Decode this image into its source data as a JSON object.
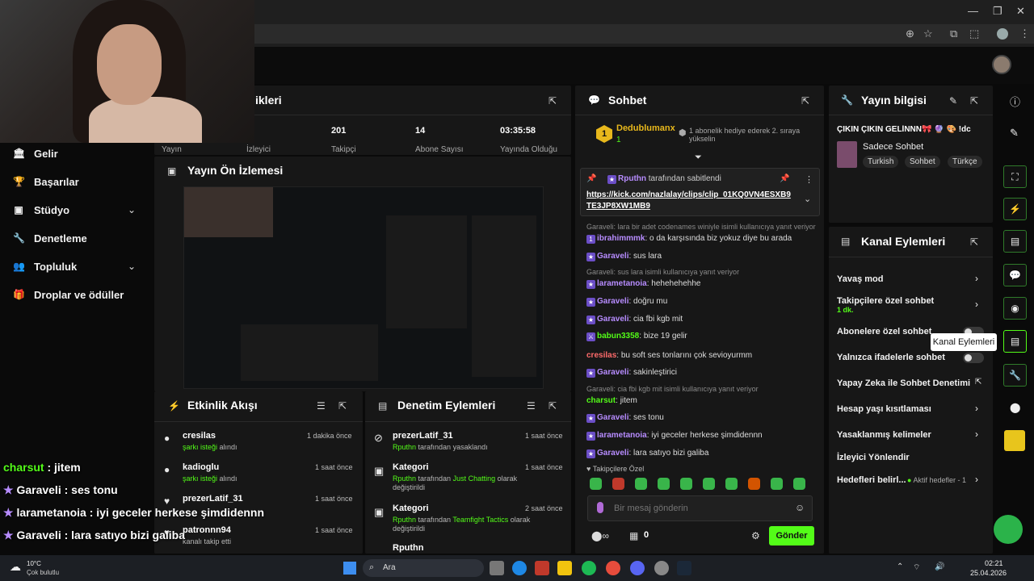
{
  "sidebar": {
    "items": [
      {
        "label": "Gelir",
        "icon": "bank-icon"
      },
      {
        "label": "Başarılar",
        "icon": "trophy-icon"
      },
      {
        "label": "Stüdyo",
        "icon": "studio-icon"
      },
      {
        "label": "Denetleme",
        "icon": "wrench-icon"
      },
      {
        "label": "Topluluk",
        "icon": "community-icon"
      },
      {
        "label": "Droplar ve ödüller",
        "icon": "gift-icon"
      }
    ]
  },
  "stats": {
    "title": "ikleri",
    "items": [
      {
        "value": "",
        "label": "Yayın"
      },
      {
        "value": "",
        "label": "İzleyici"
      },
      {
        "value": "201",
        "label": "Takipçi"
      },
      {
        "value": "14",
        "label": "Abone Sayısı"
      },
      {
        "value": "03:35:58",
        "label": "Yayında Olduğu"
      }
    ]
  },
  "preview": {
    "title": "Yayın Ön İzlemesi"
  },
  "activity": {
    "title": "Etkinlik Akışı",
    "rows": [
      {
        "name": "cresilas",
        "sub": "şarkı isteği",
        "sub2": " alındı",
        "time": "1 dakika önce"
      },
      {
        "name": "kadioglu",
        "sub": "şarkı isteği",
        "sub2": " alındı",
        "time": "1 saat önce"
      },
      {
        "name": "prezerLatif_31",
        "sub": "",
        "sub2": "",
        "time": "1 saat önce"
      },
      {
        "name": "patronnn94",
        "sub": "",
        "sub2": "kanalı takip etti",
        "time": "1 saat önce"
      }
    ]
  },
  "moderation": {
    "title": "Denetim Eylemleri",
    "rows": [
      {
        "name": "prezerLatif_31",
        "line1": "Rputhn",
        "line1b": " tarafından yasaklandı",
        "line2": "",
        "time": "1 saat önce"
      },
      {
        "name": "Kategori",
        "line1": "Rputhn",
        "line1b": " tarafından ",
        "hl": "Just Chatting",
        "line1c": " olarak",
        "line2": "değiştirildi",
        "time": "1 saat önce"
      },
      {
        "name": "Kategori",
        "line1": "Rputhn",
        "line1b": " tarafından ",
        "hl": "Teamfight Tactics",
        "line1c": " olarak",
        "line2": "değiştirildi",
        "time": "2 saat önce"
      },
      {
        "name": "Rputhn",
        "line1": "",
        "line1b": "",
        "line2": "",
        "time": ""
      }
    ]
  },
  "chat": {
    "title": "Sohbet",
    "top_user": "Dedublumanx",
    "top_count": "1",
    "gift_text": "1 abonelik hediye ederek 2. sıraya yükselin",
    "pinned_by": "Rputhn",
    "pinned_label": "tarafından sabitlendi",
    "pinned_link": "https://kick.com/nazlalay/clips/clip_01KQ0VN4ESXB9TE3JP8XW1MB9",
    "messages": [
      {
        "type": "reply",
        "text": "Garaveli: lara bir adet codenames winiyle isimli kullanıcıya yanıt veriyor"
      },
      {
        "type": "msg",
        "user": "ibrahimmmk",
        "color": "#b78cff",
        "text": "o da karşısında biz yokuz diye bu arada",
        "badge": "1"
      },
      {
        "type": "msg",
        "user": "Garaveli",
        "color": "#b78cff",
        "text": "sus lara",
        "badge": "★"
      },
      {
        "type": "reply",
        "text": "Garaveli: sus lara isimli kullanıcıya yanıt veriyor"
      },
      {
        "type": "msg",
        "user": "larametanoia",
        "color": "#b78cff",
        "text": "hehehehehhe",
        "badge": "★"
      },
      {
        "type": "msg",
        "user": "Garaveli",
        "color": "#b78cff",
        "text": "doğru mu",
        "badge": "★"
      },
      {
        "type": "msg",
        "user": "Garaveli",
        "color": "#b78cff",
        "text": "cia fbi kgb mit",
        "badge": "★"
      },
      {
        "type": "msg",
        "user": "babun3358",
        "color": "#53fc18",
        "text": "bize 19 gelir",
        "badge": "⚔"
      },
      {
        "type": "msg",
        "user": "cresilas",
        "color": "#ff6b6b",
        "text": "bu soft ses tonlarını çok sevioyurmm",
        "badge": ""
      },
      {
        "type": "msg",
        "user": "Garaveli",
        "color": "#b78cff",
        "text": "sakinleştirici",
        "badge": "★"
      },
      {
        "type": "reply",
        "text": "Garaveli: cia fbi kgb mit isimli kullanıcıya yanıt veriyor"
      },
      {
        "type": "msg",
        "user": "charsut",
        "color": "#53fc18",
        "text": "jitem",
        "badge": ""
      },
      {
        "type": "msg",
        "user": "Garaveli",
        "color": "#b78cff",
        "text": "ses tonu",
        "badge": "★"
      },
      {
        "type": "msg",
        "user": "larametanoia",
        "color": "#b78cff",
        "text": "iyi geceler herkese şimdidennn",
        "badge": "★"
      },
      {
        "type": "msg",
        "user": "Garaveli",
        "color": "#b78cff",
        "text": "lara satıyo bizi galiba",
        "badge": "★"
      }
    ],
    "followers_only": "Takipçilere Özel",
    "input_placeholder": "Bir mesaj gönderin",
    "count": "0",
    "send_label": "Gönder"
  },
  "stream_info": {
    "title": "Yayın bilgisi",
    "stream_title": "ÇIKIN ÇIKIN GELİNNN🎀 🔮 🎨 !dc",
    "category": "Sadece Sohbet",
    "tags": [
      "Turkish",
      "Sohbet",
      "Türkçe"
    ]
  },
  "channel_actions": {
    "title": "Kanal Eylemleri",
    "rows": [
      {
        "label": "Yavaş mod",
        "kind": "arrow",
        "sub": ""
      },
      {
        "label": "Takipçilere özel sohbet",
        "kind": "arrow",
        "sub": "1 dk."
      },
      {
        "label": "Abonelere özel sohbet",
        "kind": "toggle",
        "sub": ""
      },
      {
        "label": "Yalnızca ifadelerle sohbet",
        "kind": "toggle",
        "sub": ""
      },
      {
        "label": "Yapay Zeka ile Sohbet Denetimi",
        "kind": "external",
        "sub": ""
      },
      {
        "label": "Hesap yaşı kısıtlaması",
        "kind": "arrow",
        "sub": ""
      },
      {
        "label": "Yasaklanmış kelimeler",
        "kind": "arrow",
        "sub": ""
      },
      {
        "label": "İzleyici Yönlendir",
        "kind": "none",
        "sub": ""
      },
      {
        "label": "Hedefleri belirl...",
        "kind": "arrow",
        "sub": "Aktif hedefler - 1"
      }
    ],
    "tooltip": "Kanal Eylemleri"
  },
  "overlay_chat": [
    {
      "user": "charsut",
      "text": " : jitem",
      "color": "#53fc18"
    },
    {
      "user": "Garaveli",
      "text": " : ses tonu",
      "color": "#b78cff"
    },
    {
      "user": "larametanoia",
      "text": " : iyi geceler herkese şimdidennn",
      "color": "#b78cff"
    },
    {
      "user": "Garaveli",
      "text": " : lara satıyo bizi galiba",
      "color": "#b78cff"
    }
  ],
  "taskbar": {
    "weather_temp": "10°C",
    "weather_desc": "Çok bulutlu",
    "search": "Ara",
    "time": "02:21",
    "date": "25.04.2026"
  },
  "colors": {
    "accent": "#53fc18",
    "panel": "#171717",
    "bg": "#0a0a0a"
  }
}
